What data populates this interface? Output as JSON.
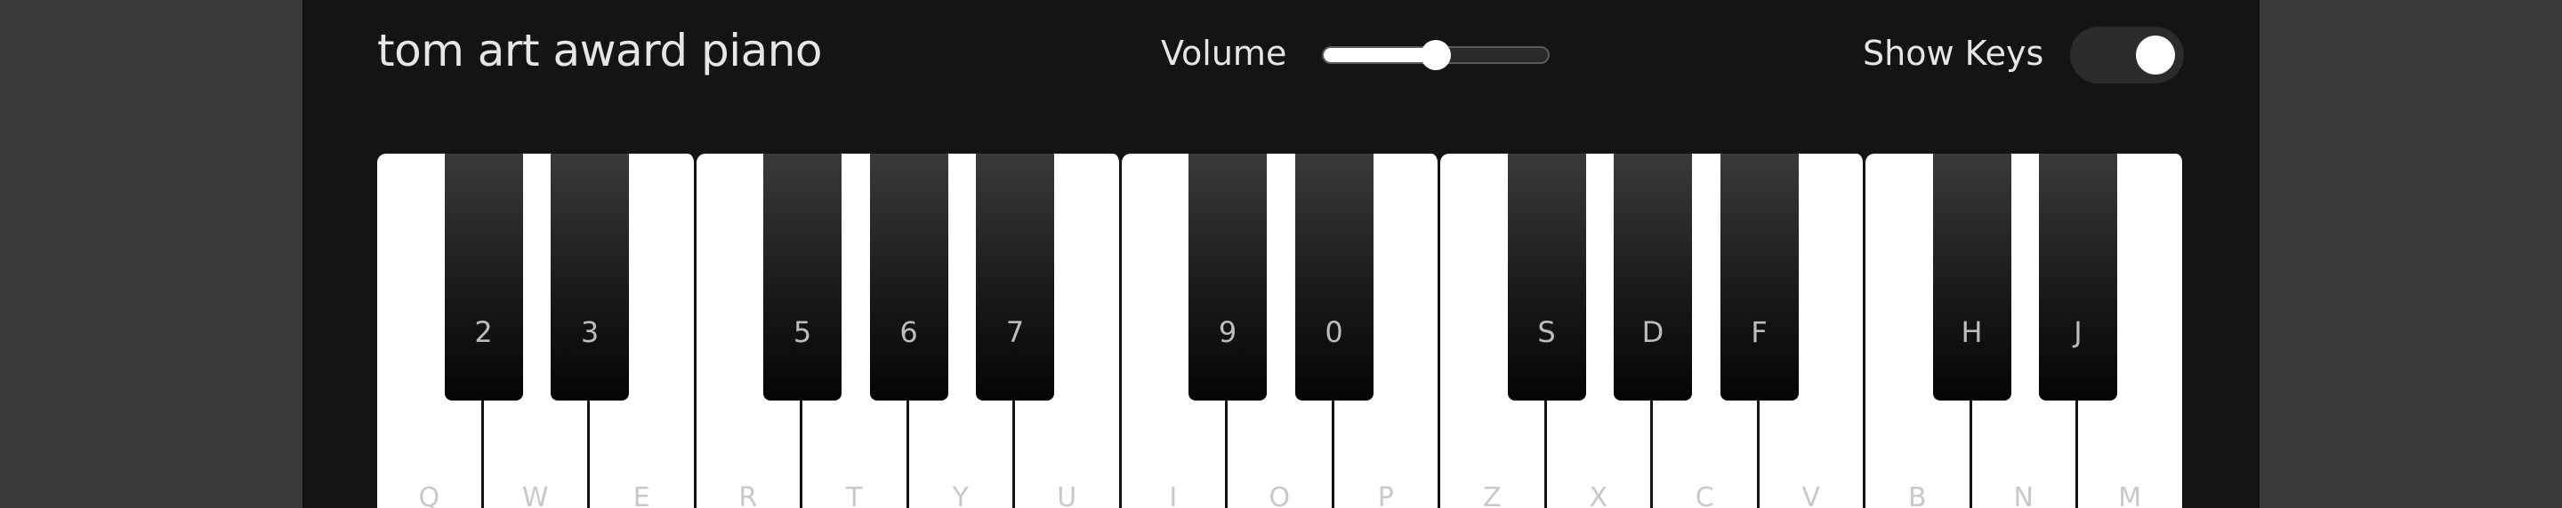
{
  "header": {
    "title": "tom art award piano",
    "volume_label": "Volume",
    "volume_value": 0.5,
    "show_keys_label": "Show Keys",
    "show_keys_on": true
  },
  "piano": {
    "white_keys": [
      "Q",
      "W",
      "E",
      "R",
      "T",
      "Y",
      "U",
      "I",
      "O",
      "P",
      "Z",
      "X",
      "C",
      "V",
      "B",
      "N",
      "M"
    ],
    "black_keys": [
      "2",
      "3",
      "5",
      "6",
      "7",
      "9",
      "0",
      "S",
      "D",
      "F",
      "H",
      "J"
    ]
  }
}
